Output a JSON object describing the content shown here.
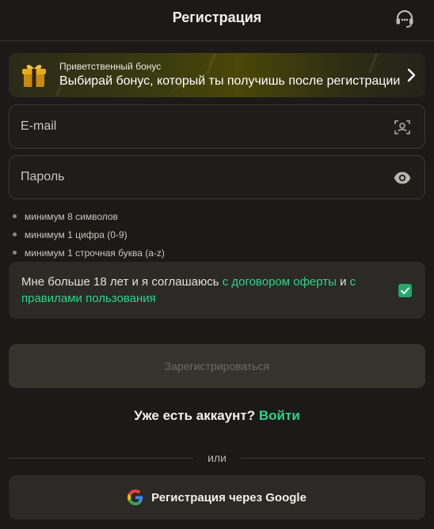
{
  "header": {
    "title": "Регистрация",
    "support_icon": "headset-icon"
  },
  "bonus": {
    "subtitle": "Приветственный бонус",
    "text": "Выбирай бонус, который ты получишь после регистрации",
    "icon": "gift-icon"
  },
  "form": {
    "email_placeholder": "E-mail",
    "email_value": "",
    "password_placeholder": "Пароль",
    "password_value": "",
    "password_rules": [
      "минимум 8 символов",
      "минимум 1 цифра (0-9)",
      "минимум 1 строчная буква (a-z)"
    ],
    "agreement": {
      "text_before": "Мне больше 18 лет и я соглашаюсь ",
      "link_offer": "с договором оферты",
      "text_and": " и ",
      "link_rules": "с правилами пользования",
      "checked": true
    },
    "submit_label": "Зарегистрироваться"
  },
  "login": {
    "question": "Уже есть аккаунт?",
    "link": "Войти"
  },
  "divider_label": "или",
  "google_button_label": "Регистрация через Google",
  "colors": {
    "background": "#1b1a18",
    "accent": "#2fd38b",
    "checkbox": "#1fa86a"
  }
}
